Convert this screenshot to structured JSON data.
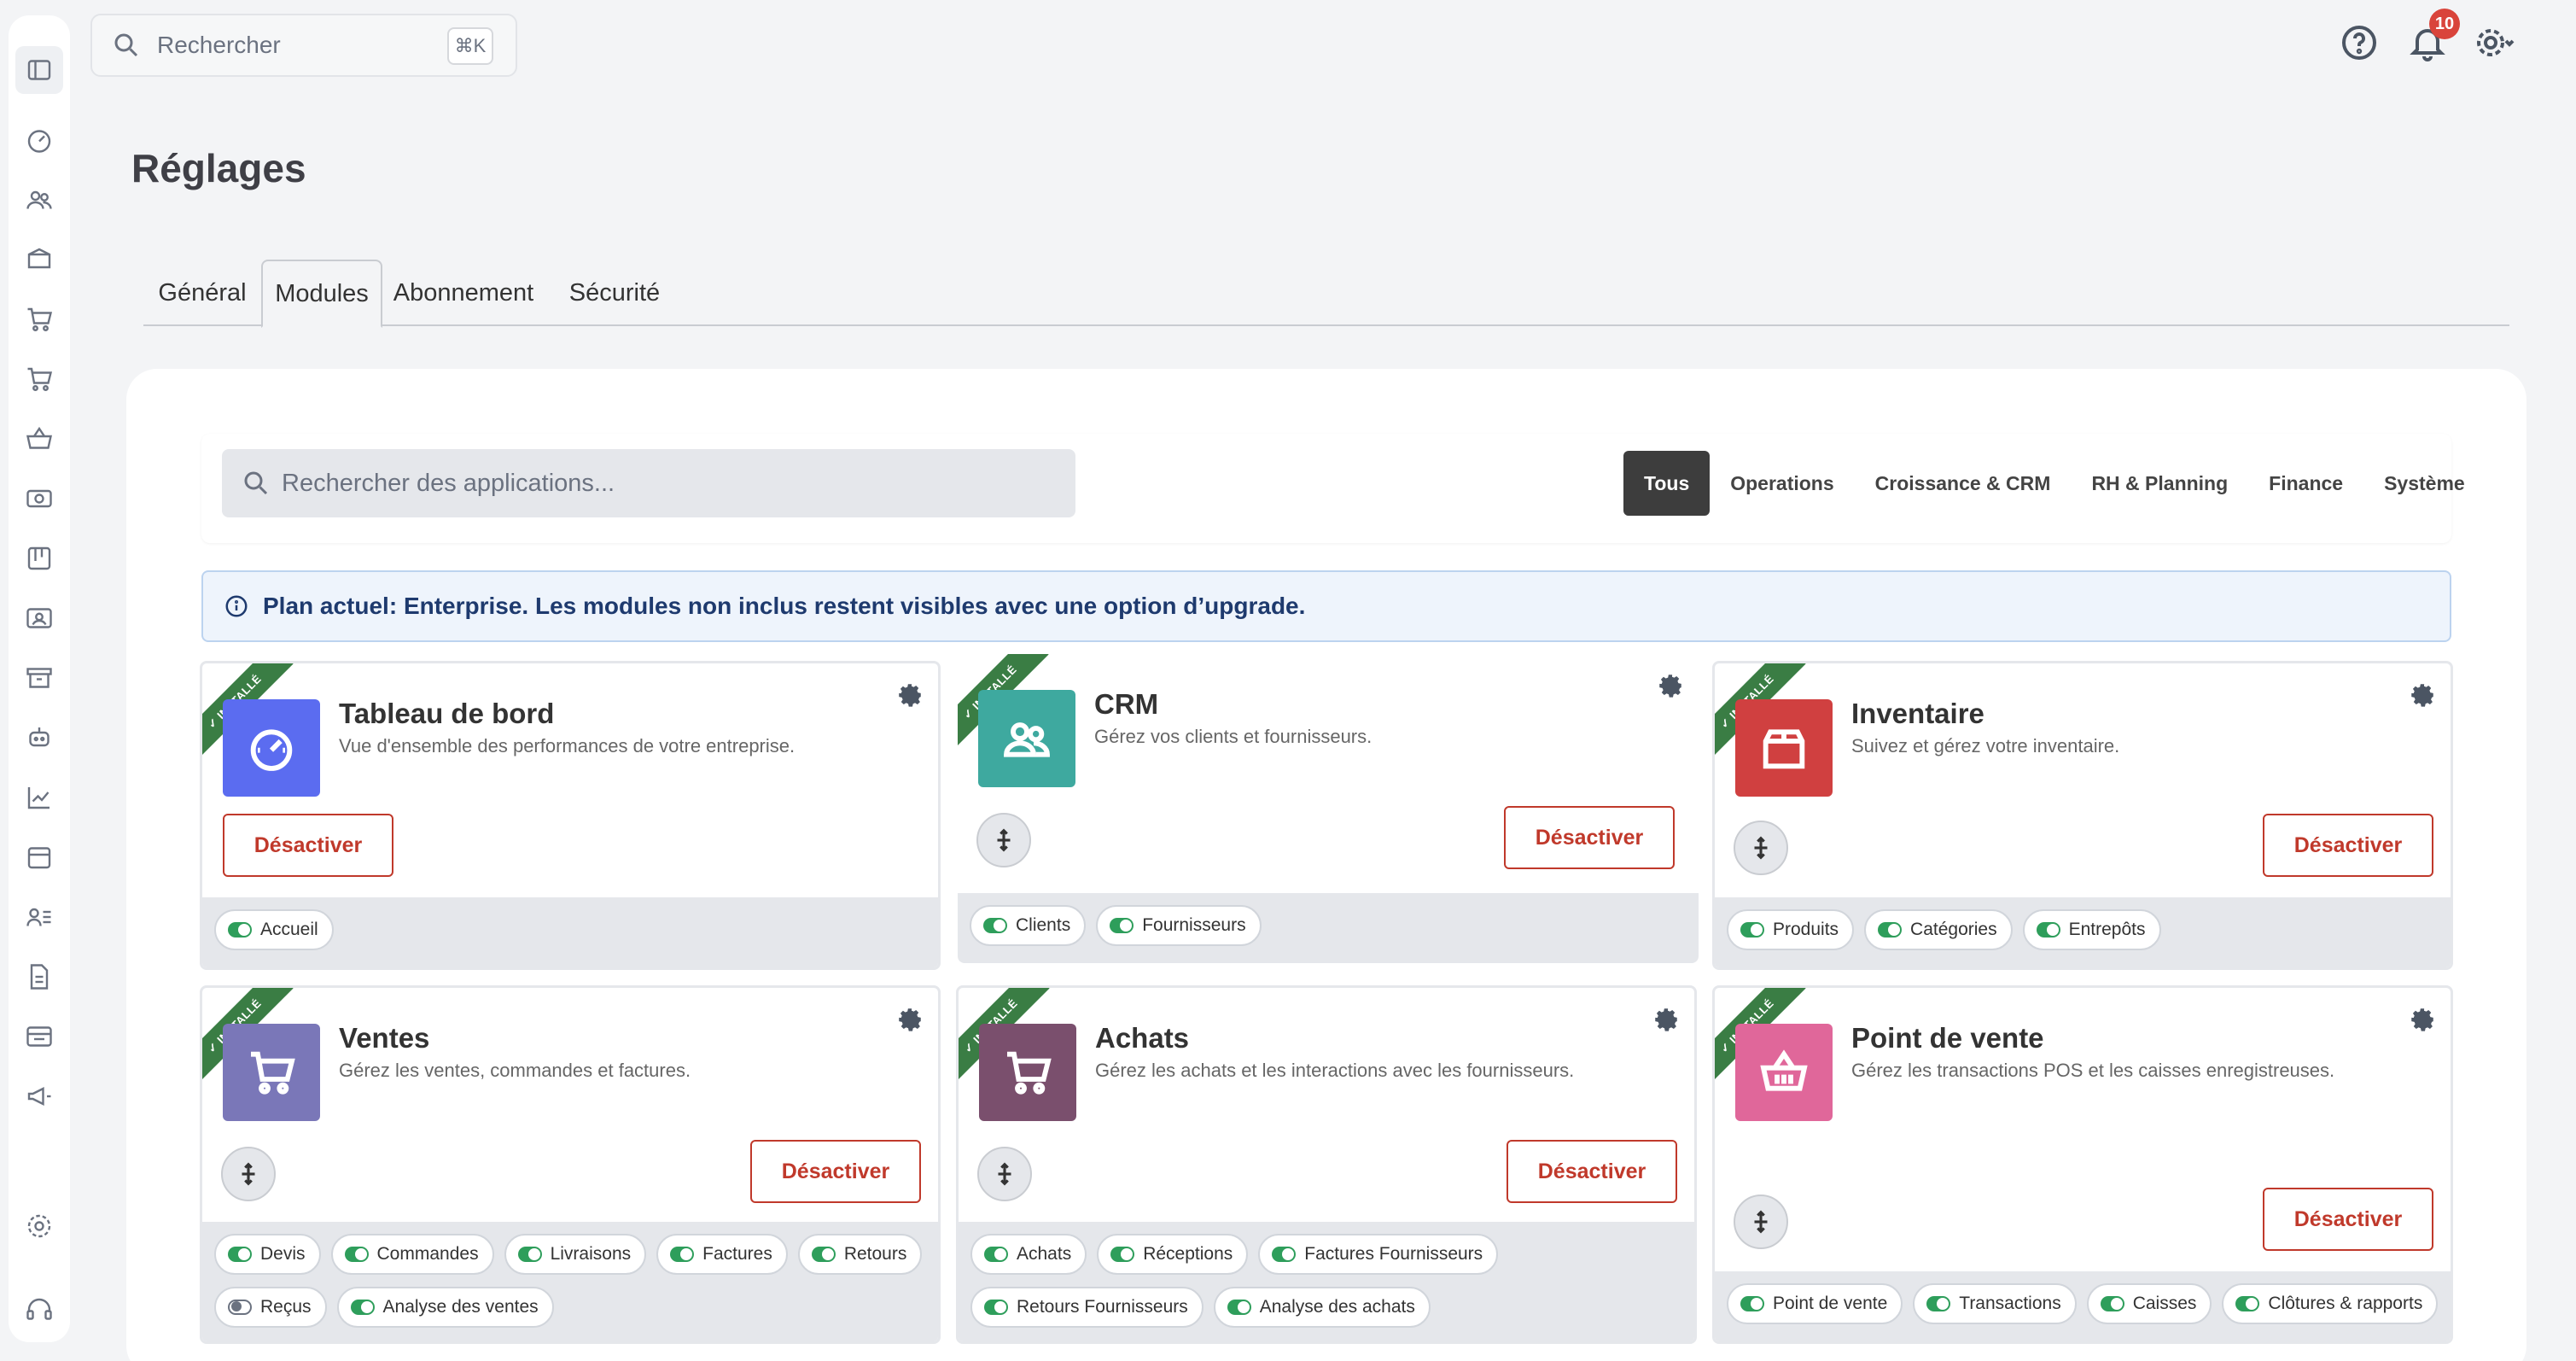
{
  "search": {
    "placeholder": "Rechercher",
    "shortcut": "⌘K"
  },
  "topbar": {
    "notifications_count": "10"
  },
  "page": {
    "title": "Réglages"
  },
  "tabs": [
    {
      "label": "Général"
    },
    {
      "label": "Modules",
      "active": true
    },
    {
      "label": "Abonnement"
    },
    {
      "label": "Sécurité"
    }
  ],
  "filters": {
    "search_placeholder": "Rechercher des applications...",
    "categories": [
      "Tous",
      "Operations",
      "Croissance & CRM",
      "RH & Planning",
      "Finance",
      "Système"
    ],
    "active": "Tous"
  },
  "banner": {
    "text": "Plan actuel: Enterprise. Les modules non inclus restent visibles avec une option d’upgrade."
  },
  "modules": [
    {
      "title": "Tableau de bord",
      "description": "Vue d'ensemble des performances de votre entreprise.",
      "ribbon": "✓ INSTALLÉ",
      "action": "Désactiver",
      "color": "#5b6cf0",
      "icon": "gauge-icon",
      "features": [
        {
          "label": "Accueil",
          "on": true
        }
      ]
    },
    {
      "title": "CRM",
      "description": "Gérez vos clients et fournisseurs.",
      "ribbon": "✓ INSTALLÉ",
      "action": "Désactiver",
      "color": "#3ea99f",
      "icon": "users-icon",
      "features": [
        {
          "label": "Clients",
          "on": true
        },
        {
          "label": "Fournisseurs",
          "on": true
        }
      ]
    },
    {
      "title": "Inventaire",
      "description": "Suivez et gérez votre inventaire.",
      "ribbon": "✓ INSTALLÉ",
      "action": "Désactiver",
      "color": "#d04040",
      "icon": "box-icon",
      "features": [
        {
          "label": "Produits",
          "on": true
        },
        {
          "label": "Catégories",
          "on": true
        },
        {
          "label": "Entrepôts",
          "on": true
        }
      ]
    },
    {
      "title": "Ventes",
      "description": "Gérez les ventes, commandes et factures.",
      "ribbon": "✓ INSTALLÉ",
      "action": "Désactiver",
      "color": "#7a77b8",
      "icon": "cart-icon",
      "features": [
        {
          "label": "Devis",
          "on": true
        },
        {
          "label": "Commandes",
          "on": true
        },
        {
          "label": "Livraisons",
          "on": true
        },
        {
          "label": "Factures",
          "on": true
        },
        {
          "label": "Retours",
          "on": true
        },
        {
          "label": "Reçus",
          "on": false
        },
        {
          "label": "Analyse des ventes",
          "on": true
        }
      ]
    },
    {
      "title": "Achats",
      "description": "Gérez les achats et les interactions avec les fournisseurs.",
      "ribbon": "✓ INSTALLÉ",
      "action": "Désactiver",
      "color": "#7a4f6d",
      "icon": "cart-icon",
      "features": [
        {
          "label": "Achats",
          "on": true
        },
        {
          "label": "Réceptions",
          "on": true
        },
        {
          "label": "Factures Fournisseurs",
          "on": true
        },
        {
          "label": "Retours Fournisseurs",
          "on": true
        },
        {
          "label": "Analyse des achats",
          "on": true
        }
      ]
    },
    {
      "title": "Point de vente",
      "description": "Gérez les transactions POS et les caisses enregistreuses.",
      "ribbon": "✓ INSTALLÉ",
      "action": "Désactiver",
      "color": "#e0679a",
      "icon": "basket-icon",
      "features": [
        {
          "label": "Point de vente",
          "on": true
        },
        {
          "label": "Transactions",
          "on": true
        },
        {
          "label": "Caisses",
          "on": true
        },
        {
          "label": "Clôtures & rapports",
          "on": true
        }
      ]
    }
  ]
}
